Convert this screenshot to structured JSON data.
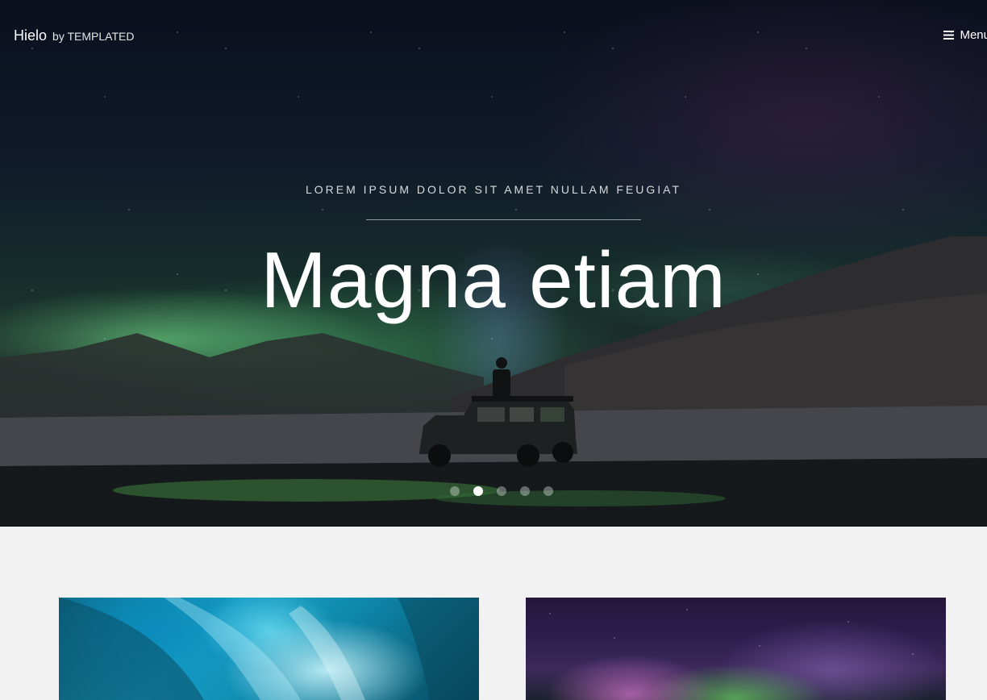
{
  "header": {
    "logo_name": "Hielo",
    "logo_by": "by TEMPLATED",
    "menu_label": "Menu",
    "menu_icon": "bars-icon"
  },
  "banner": {
    "tagline": "LOREM IPSUM DOLOR SIT AMET NULLAM FEUGIAT",
    "headline": "Magna etiam",
    "slides": {
      "count": 5,
      "active_index": 1
    }
  },
  "gallery": [
    {
      "image": "ice-cave-image"
    },
    {
      "image": "aurora-image"
    }
  ],
  "colors": {
    "page_background": "#f2f2f2",
    "text_light": "#ffffff"
  }
}
